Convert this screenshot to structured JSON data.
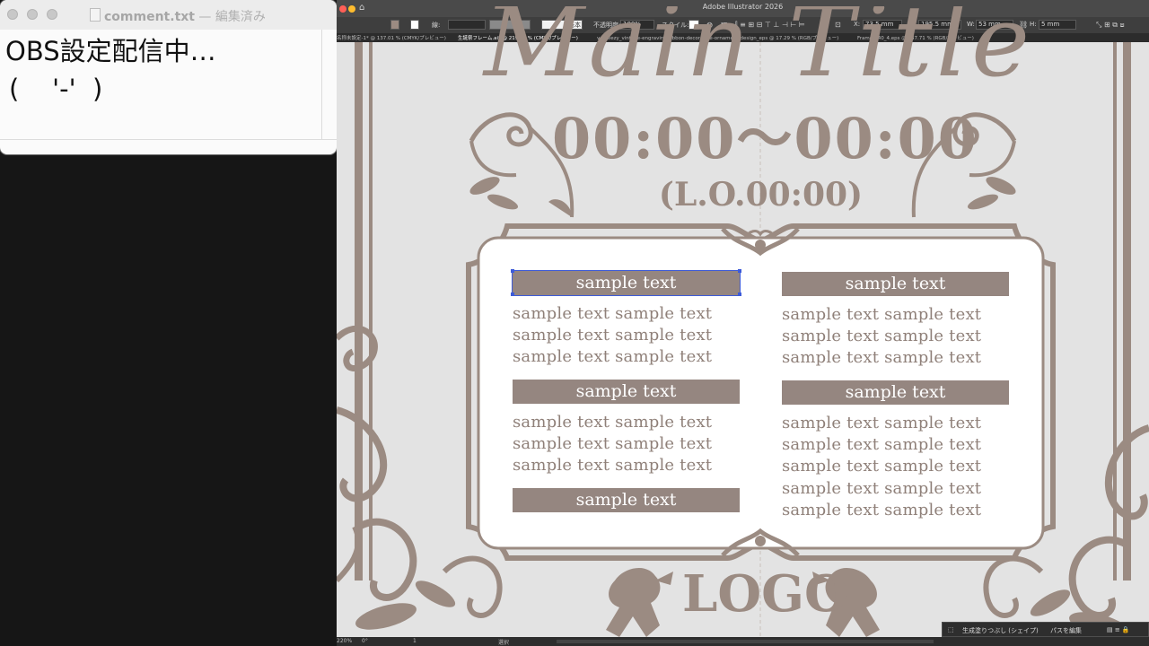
{
  "textedit": {
    "filename": "comment.txt",
    "status": " — 編集済み",
    "line1": "OBS設定配信中…",
    "line2": "(    '-'  )"
  },
  "illustrator": {
    "app_title": "Adobe Illustrator 2026",
    "control": {
      "stroke_label": "線:",
      "stroke_style": "基本",
      "opacity_label": "不透明度:",
      "opacity_value": "100%",
      "style_label": "スタイル:",
      "x_label": "X:",
      "x_value": "73.5 mm",
      "y_label": "Y:",
      "y_value": "195.5 mm",
      "w_label": "W:",
      "w_value": "53 mm",
      "h_label": "H:",
      "h_value": "5 mm"
    },
    "tabs": [
      {
        "label": "名称未設定-1* @ 137.01 % (CMYK/プレビュー)"
      },
      {
        "label": "生誕祭フレーム.ai* @ 219.99 % (CMYK/プレビュー)"
      },
      {
        "label": "vecteezy_vintage-engraving-ribbon-decorative-ornament-design_eps @ 17.29 % (RGB/プレビュー)"
      },
      {
        "label": "Frames_40_4.eps @ 137.71 % (RGB/プレビュー)"
      }
    ],
    "status": {
      "zoom": "220%",
      "rotate": "0°",
      "artboard": "1",
      "tool": "選択"
    },
    "contextbar": {
      "generative_fill": "生成塗りつぶし (シェイプ)",
      "edit_path": "パスを編集"
    }
  },
  "artwork": {
    "title_partial": "Main Title",
    "time": "00:00～00:00",
    "last_order": "(L.O.00:00)",
    "logo": "LOGO",
    "left_column": {
      "headers": [
        "sample text",
        "sample text",
        "sample text"
      ],
      "paragraphs": [
        [
          "sample text sample text",
          "sample text sample text",
          "sample text sample text"
        ],
        [
          "sample text sample text",
          "sample text sample text",
          "sample text sample text"
        ]
      ]
    },
    "right_column": {
      "headers": [
        "sample text",
        "sample text"
      ],
      "paragraphs": [
        [
          "sample text sample text",
          "sample text sample text",
          "sample text sample text"
        ],
        [
          "sample text sample text",
          "sample text sample text",
          "sample text sample text",
          "sample text sample text",
          "sample text sample text"
        ]
      ]
    }
  },
  "colors": {
    "ornament": "#9b8b82",
    "label_bar": "#958680",
    "body_text": "#8f8079"
  }
}
